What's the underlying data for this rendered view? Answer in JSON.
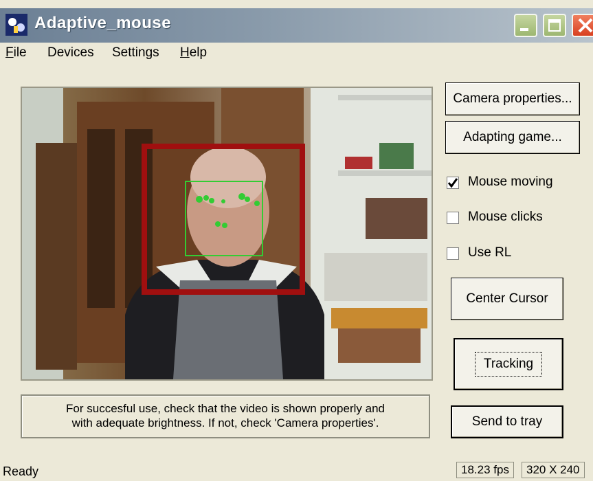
{
  "window": {
    "title": "Adaptive_mouse"
  },
  "menu": [
    "File",
    "Devices",
    "Settings",
    "Help"
  ],
  "buttons": {
    "camera_properties": "Camera properties...",
    "adapting_game": "Adapting game...",
    "center_cursor": "Center Cursor",
    "tracking": "Tracking",
    "send_to_tray": "Send to tray"
  },
  "checkboxes": [
    {
      "label": "Mouse moving",
      "checked": true
    },
    {
      "label": "Mouse clicks",
      "checked": false
    },
    {
      "label": "Use RL",
      "checked": false
    }
  ],
  "hint": {
    "line1": "For succesful use, check that the video is shown properly and",
    "line2": "with adequate brightness. If not, check 'Camera properties'."
  },
  "status": {
    "text": "Ready",
    "fps": "18.23 fps",
    "resolution": "320 X 240"
  },
  "colors": {
    "face_box": "#a00f0f",
    "feature_box": "#33cc33",
    "titlebar": "#8a9bab"
  },
  "icons": {
    "app": "mouse-tracking-icon",
    "minimize": "minimize-icon",
    "maximize": "maximize-icon",
    "close": "close-icon"
  }
}
